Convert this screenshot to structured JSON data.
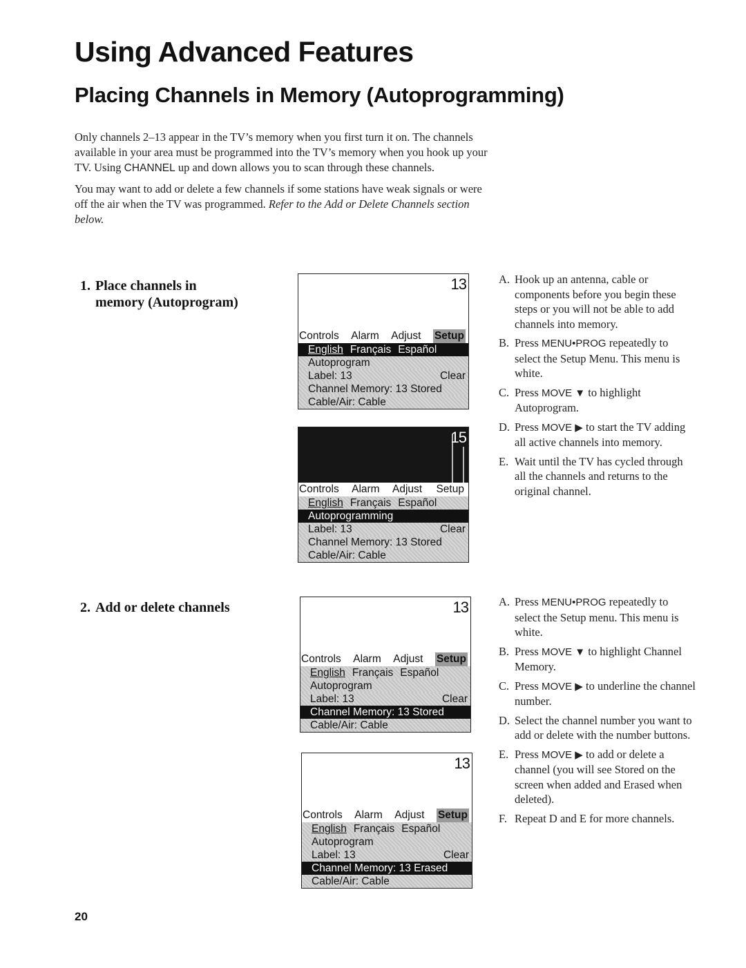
{
  "title": "Using Advanced Features",
  "subtitle": "Placing Channels in Memory (Autoprogramming)",
  "intro": {
    "p1_a": "Only channels 2–13 appear in the TV’s memory when you first turn it on. The channels available in your area must be programmed into the TV’s memory when you hook up your TV. Using ",
    "p1_key": "CHANNEL",
    "p1_b": " up and down allows you to scan through these channels.",
    "p2_a": "You may want to add or delete a few channels if some stations have weak signals or were off the air when the TV was programmed. ",
    "p2_italic": "Refer to the Add or Delete Channels section below."
  },
  "sections": [
    {
      "number": "1.",
      "title_line1": "Place channels in",
      "title_line2": "memory (Autoprogram)",
      "screens": [
        {
          "channel": "13",
          "tabs": [
            "Controls",
            "Alarm",
            "Adjust",
            "Setup"
          ],
          "languages": [
            "English",
            "Français",
            "Español"
          ],
          "rows": {
            "autoprogram": "Autoprogram",
            "label": "Label: 13",
            "clear": "Clear",
            "memory": "Channel Memory: 13 Stored",
            "cable": "Cable/Air: Cable"
          },
          "highlighted": "languages"
        },
        {
          "channel": "15",
          "tabs": [
            "Controls",
            "Alarm",
            "Adjust",
            "Setup"
          ],
          "languages": [
            "English",
            "Français",
            "Español"
          ],
          "rows": {
            "autoprogram": "Autoprogramming",
            "label": "Label: 13",
            "clear": "Clear",
            "memory": "Channel Memory: 13 Stored",
            "cable": "Cable/Air: Cable"
          },
          "highlighted": "autoprogram"
        }
      ],
      "steps": [
        {
          "letter": "A.",
          "text": "Hook up an antenna, cable or components before you begin these steps or you will not be able to add channels into memory."
        },
        {
          "letter": "B.",
          "pre": "Press ",
          "key": "MENU•PROG",
          "post": " repeatedly to select the Setup Menu. This menu is white."
        },
        {
          "letter": "C.",
          "pre": "Press ",
          "key": "MOVE ▼",
          "post": " to highlight Autoprogram."
        },
        {
          "letter": "D.",
          "pre": "Press ",
          "key": "MOVE ▶",
          "post": " to start the TV adding all active channels into memory."
        },
        {
          "letter": "E.",
          "text": "Wait until the TV has cycled through all the channels and returns to the original channel."
        }
      ]
    },
    {
      "number": "2.",
      "title_line1": "Add or delete channels",
      "screens": [
        {
          "channel": "13",
          "tabs": [
            "Controls",
            "Alarm",
            "Adjust",
            "Setup"
          ],
          "languages": [
            "English",
            "Français",
            "Español"
          ],
          "rows": {
            "autoprogram": "Autoprogram",
            "label": "Label: 13",
            "clear": "Clear",
            "memory": "Channel Memory: 13 Stored",
            "cable": "Cable/Air: Cable"
          },
          "highlighted": "memory"
        },
        {
          "channel": "13",
          "tabs": [
            "Controls",
            "Alarm",
            "Adjust",
            "Setup"
          ],
          "languages": [
            "English",
            "Français",
            "Español"
          ],
          "rows": {
            "autoprogram": "Autoprogram",
            "label": "Label: 13",
            "clear": "Clear",
            "memory": "Channel Memory: 13 Erased",
            "cable": "Cable/Air: Cable"
          },
          "highlighted": "memory"
        }
      ],
      "steps": [
        {
          "letter": "A.",
          "pre": "Press ",
          "key": "MENU•PROG",
          "post": " repeatedly to select the Setup menu. This menu is white."
        },
        {
          "letter": "B.",
          "pre": "Press ",
          "key": "MOVE ▼",
          "post": " to highlight Channel Memory."
        },
        {
          "letter": "C.",
          "pre": "Press ",
          "key": "MOVE ▶",
          "post": " to underline the channel number."
        },
        {
          "letter": "D.",
          "text": "Select the channel number you want to add or delete with the number buttons."
        },
        {
          "letter": "E.",
          "pre": "Press ",
          "key": "MOVE ▶",
          "post": " to add or delete a channel (you will see Stored on the screen when added and Erased when deleted)."
        },
        {
          "letter": "F.",
          "text": "Repeat D and E for more channels."
        }
      ]
    }
  ],
  "page_number": "20"
}
